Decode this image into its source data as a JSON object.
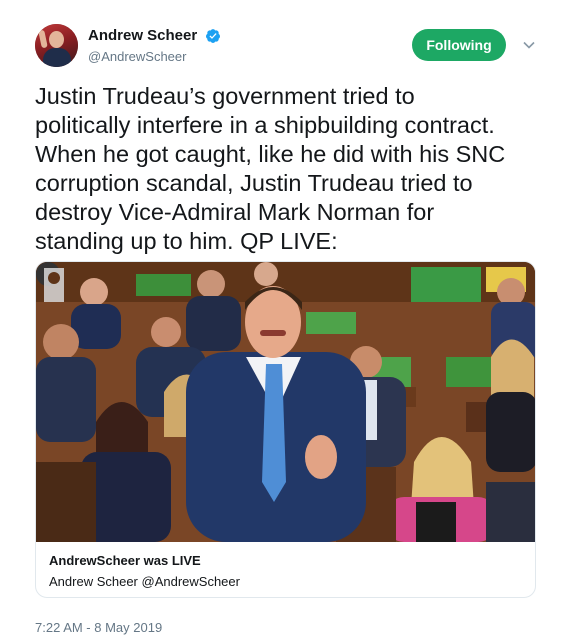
{
  "author": {
    "name": "Andrew Scheer",
    "handle": "@AndrewScheer",
    "verified_icon": "verified-badge-icon"
  },
  "actions": {
    "follow_label": "Following",
    "more_icon": "chevron-down-icon"
  },
  "tweet": {
    "lines": [
      "Justin Trudeau’s government tried to",
      "politically interfere in a shipbuilding contract.",
      "When he got caught, like he did with his SNC",
      "corruption scandal, Justin Trudeau tried to",
      "destroy Vice-Admiral Mark Norman for",
      "standing up to him. QP LIVE:"
    ]
  },
  "card": {
    "title": "AndrewScheer was LIVE",
    "subtitle": "Andrew Scheer @AndrewScheer"
  },
  "timestamp": "7:22 AM - 8 May 2019",
  "colors": {
    "follow_bg": "#1da864",
    "verified_blue": "#1da1f2",
    "secondary_text": "#657786"
  }
}
